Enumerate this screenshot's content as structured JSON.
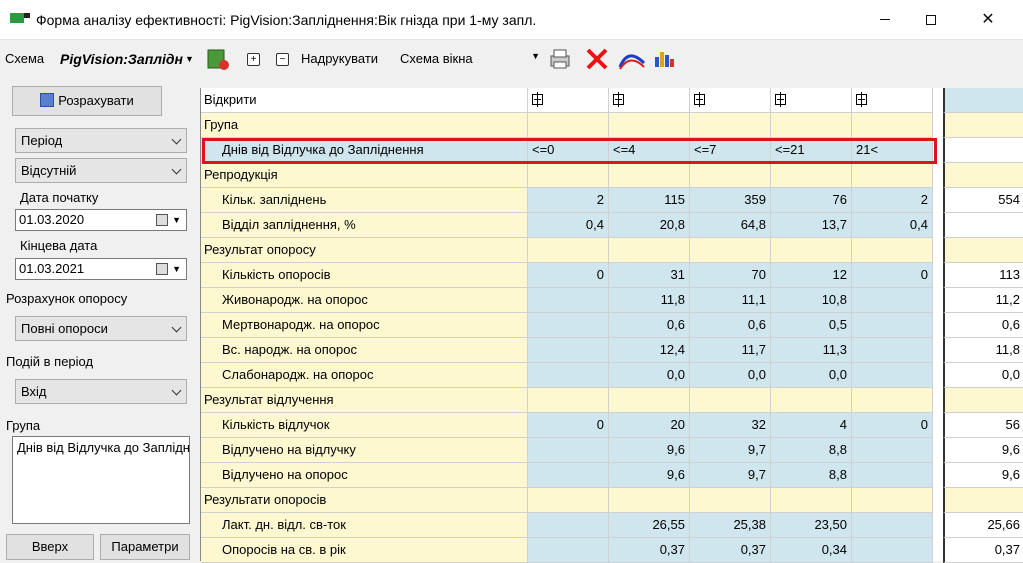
{
  "window": {
    "title": "Форма аналізу ефективності: PigVision:Запліднення:Вік гнізда при 1-му запл."
  },
  "toolbar": {
    "scheme_label": "Схема",
    "scheme_name": "PigVision:Заплідн",
    "print_label": "Надрукувати",
    "scheme_combo": "Схема вікна"
  },
  "left": {
    "calc_button": "Розрахувати",
    "period_combo": "Період",
    "absent_combo": "Відсутній",
    "start_date_label": "Дата початку",
    "start_date": "01.03.2020",
    "end_date_label": "Кінцева дата",
    "end_date": "01.03.2021",
    "farrowing_calc_label": "Розрахунок опоросу",
    "farrowing_calc_combo": "Повні опороси",
    "events_label": "Подій в період",
    "events_combo": "Вхід",
    "group_label": "Група",
    "group_value": "Днів від Відлучка  до Заплідн",
    "up_button": "Вверх",
    "params_button": "Параметри"
  },
  "grid": {
    "open_label": "Відкрити",
    "group_label": "Група",
    "group_row_label": "Днів від Відлучка  до Запліднення",
    "columns": [
      "<=0",
      "<=4",
      "<=7",
      "<=21",
      "21<"
    ],
    "sections": [
      {
        "title": "Репродукція",
        "rows": [
          {
            "label": "Кільк. запліднень",
            "values": [
              "2",
              "115",
              "359",
              "76",
              "2"
            ],
            "total": "554"
          },
          {
            "label": "Відділ запліднення, %",
            "values": [
              "0,4",
              "20,8",
              "64,8",
              "13,7",
              "0,4"
            ],
            "total": ""
          }
        ]
      },
      {
        "title": "Результат опоросу",
        "rows": [
          {
            "label": "Кількість опоросів",
            "values": [
              "0",
              "31",
              "70",
              "12",
              "0"
            ],
            "total": "113"
          },
          {
            "label": "Живонародж. на опорос",
            "values": [
              "",
              "11,8",
              "11,1",
              "10,8",
              ""
            ],
            "total": "11,2"
          },
          {
            "label": "Мертвонародж. на опорос",
            "values": [
              "",
              "0,6",
              "0,6",
              "0,5",
              ""
            ],
            "total": "0,6"
          },
          {
            "label": "Вс. народж. на опорос",
            "values": [
              "",
              "12,4",
              "11,7",
              "11,3",
              ""
            ],
            "total": "11,8"
          },
          {
            "label": "Слабонародж. на опорос",
            "values": [
              "",
              "0,0",
              "0,0",
              "0,0",
              ""
            ],
            "total": "0,0"
          }
        ]
      },
      {
        "title": "Результат відлучення",
        "rows": [
          {
            "label": "Кількість відлучок",
            "values": [
              "0",
              "20",
              "32",
              "4",
              "0"
            ],
            "total": "56"
          },
          {
            "label": "Відлучено на відлучку",
            "values": [
              "",
              "9,6",
              "9,7",
              "8,8",
              ""
            ],
            "total": "9,6"
          },
          {
            "label": "Відлучено на опорос",
            "values": [
              "",
              "9,6",
              "9,7",
              "8,8",
              ""
            ],
            "total": "9,6"
          }
        ]
      },
      {
        "title": "Результати опоросів",
        "rows": [
          {
            "label": "Лакт. дн. відл. св-ток",
            "values": [
              "",
              "26,55",
              "25,38",
              "23,50",
              ""
            ],
            "total": "25,66"
          },
          {
            "label": "Опоросів на св. в рік",
            "values": [
              "",
              "0,37",
              "0,37",
              "0,34",
              ""
            ],
            "total": "0,37"
          }
        ]
      }
    ]
  },
  "colors": {
    "section_bg": "#fdf8d0",
    "value_bg": "#cfe6ef",
    "highlight": "#e0121e"
  }
}
